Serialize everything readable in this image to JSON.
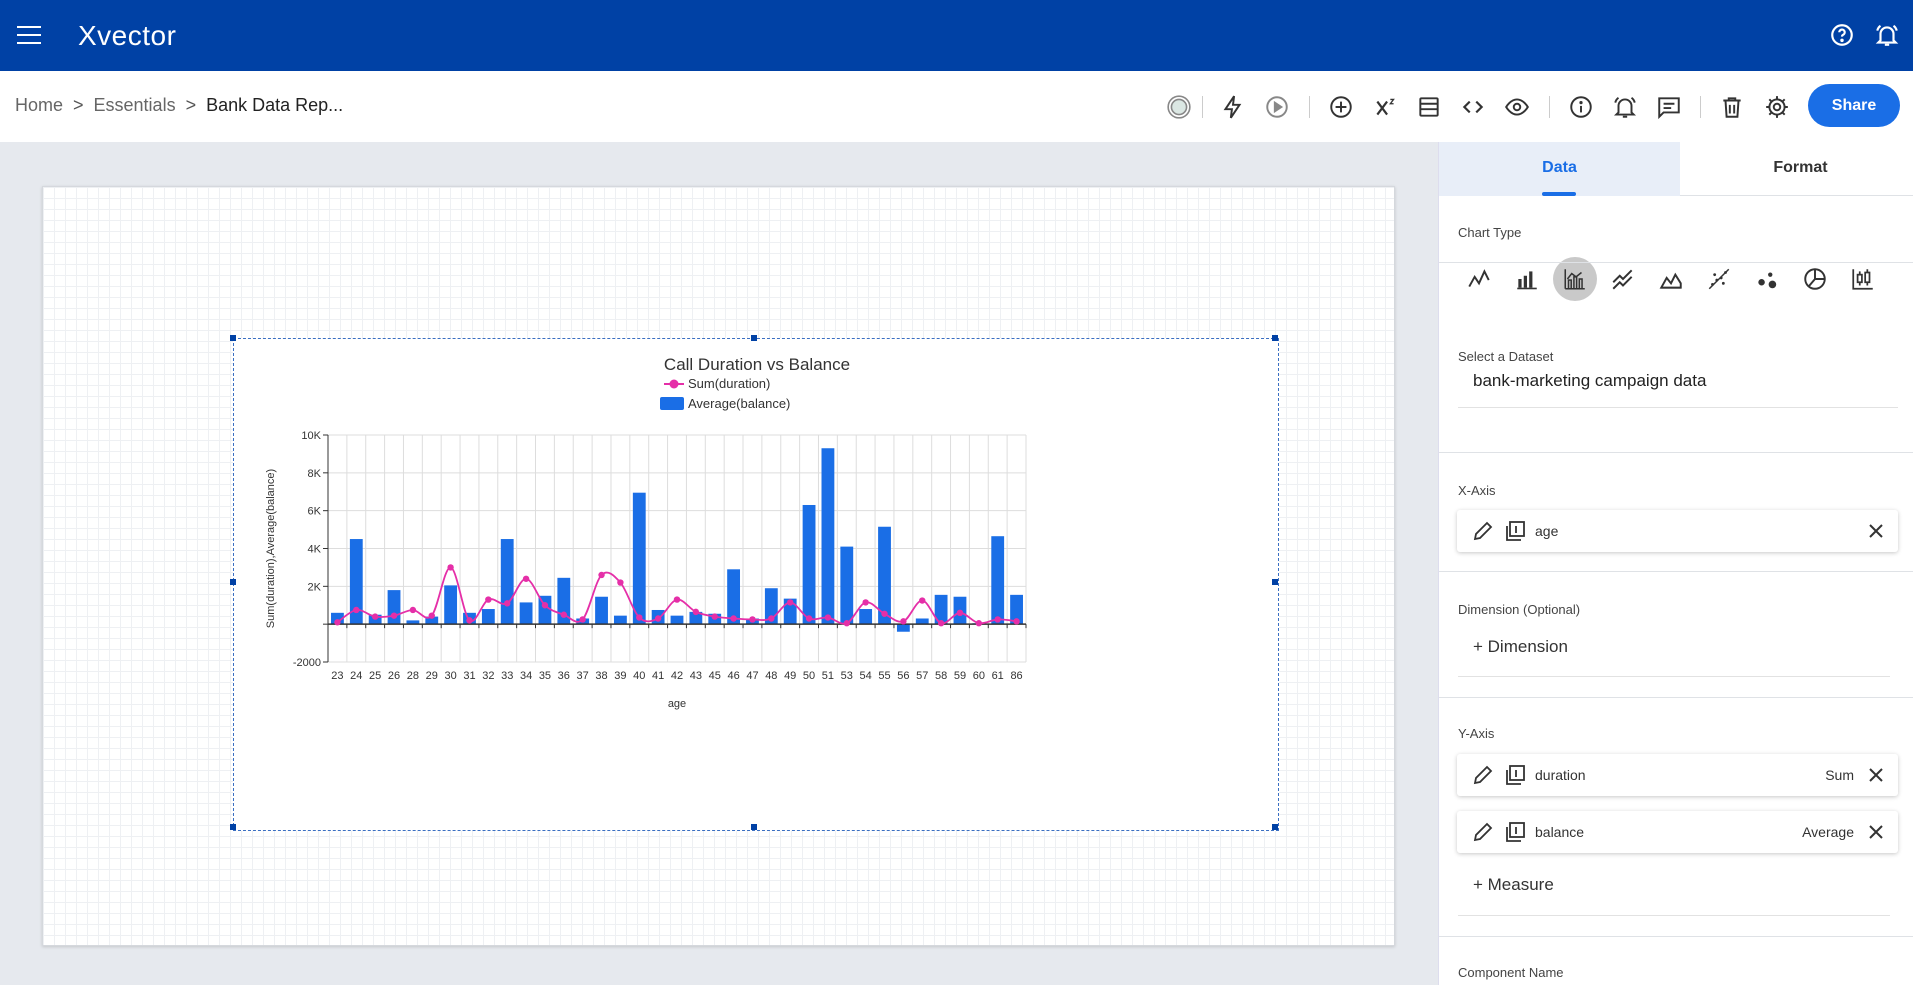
{
  "app": {
    "logo_text": "Xvector"
  },
  "colors": {
    "brand_bar": "#0041a5",
    "accent": "#1a6ee6",
    "bar": "#1a6ee6",
    "line": "#e52fa8"
  },
  "breadcrumb": {
    "items": [
      "Home",
      "Essentials"
    ],
    "current": "Bank Data Rep...",
    "separator": ">"
  },
  "toolbar": {
    "icons": [
      "status-icon",
      "lightning-icon",
      "play-icon",
      "add-circle-icon",
      "superscript-icon",
      "layout-icon",
      "code-icon",
      "eye-icon",
      "info-icon",
      "alarm-icon",
      "comment-icon",
      "trash-icon",
      "gear-icon"
    ],
    "share_label": "Share"
  },
  "panel": {
    "tabs": [
      {
        "label": "Data",
        "active": true
      },
      {
        "label": "Format",
        "active": false
      }
    ],
    "chart_type_label": "Chart Type",
    "chart_types": [
      "line",
      "bar",
      "bar-line",
      "multi-line",
      "area",
      "scatter-line",
      "bubble",
      "pie",
      "candlestick"
    ],
    "chart_type_selected": "bar-line",
    "dataset_label": "Select a Dataset",
    "dataset_value": "bank-marketing campaign data",
    "x_axis_label": "X-Axis",
    "x_axis_field": "age",
    "dimension_label": "Dimension (Optional)",
    "add_dimension": "+ Dimension",
    "y_axis_label": "Y-Axis",
    "y_axis_fields": [
      {
        "name": "duration",
        "aggregation": "Sum"
      },
      {
        "name": "balance",
        "aggregation": "Average"
      }
    ],
    "add_measure": "+ Measure",
    "component_name_label": "Component Name"
  },
  "chart_data": {
    "type": "bar",
    "title": "Call Duration vs Balance",
    "xlabel": "age",
    "ylabel": "Sum(duration),Average(balance)",
    "ylim": [
      -2000,
      10000
    ],
    "yticks": [
      -2000,
      0,
      2000,
      4000,
      6000,
      8000,
      10000
    ],
    "ytick_labels": [
      "-2000",
      "",
      "2K",
      "4K",
      "6K",
      "8K",
      "10K"
    ],
    "grid": true,
    "legend_position": "top-center",
    "categories": [
      "23",
      "24",
      "25",
      "26",
      "28",
      "29",
      "30",
      "31",
      "32",
      "33",
      "34",
      "35",
      "36",
      "37",
      "38",
      "39",
      "40",
      "41",
      "42",
      "43",
      "45",
      "46",
      "47",
      "48",
      "49",
      "50",
      "51",
      "53",
      "54",
      "55",
      "56",
      "57",
      "58",
      "59",
      "60",
      "61",
      "86"
    ],
    "series": [
      {
        "name": "Sum(duration)",
        "type": "line",
        "color": "#e52fa8",
        "values": [
          100,
          750,
          400,
          450,
          750,
          450,
          3000,
          200,
          1300,
          1100,
          2400,
          1000,
          500,
          250,
          2600,
          2200,
          350,
          300,
          1300,
          650,
          400,
          300,
          250,
          300,
          1150,
          300,
          350,
          50,
          1150,
          550,
          150,
          1250,
          50,
          600,
          50,
          250,
          150
        ]
      },
      {
        "name": "Average(balance)",
        "type": "bar",
        "color": "#1a6ee6",
        "values": [
          600,
          4500,
          500,
          1800,
          200,
          400,
          2050,
          600,
          800,
          4500,
          1150,
          1500,
          2450,
          300,
          1450,
          450,
          6950,
          750,
          450,
          650,
          550,
          2900,
          300,
          1900,
          1350,
          6300,
          9300,
          4100,
          800,
          5150,
          -400,
          300,
          1550,
          1450,
          50,
          4650,
          1550
        ]
      }
    ]
  }
}
